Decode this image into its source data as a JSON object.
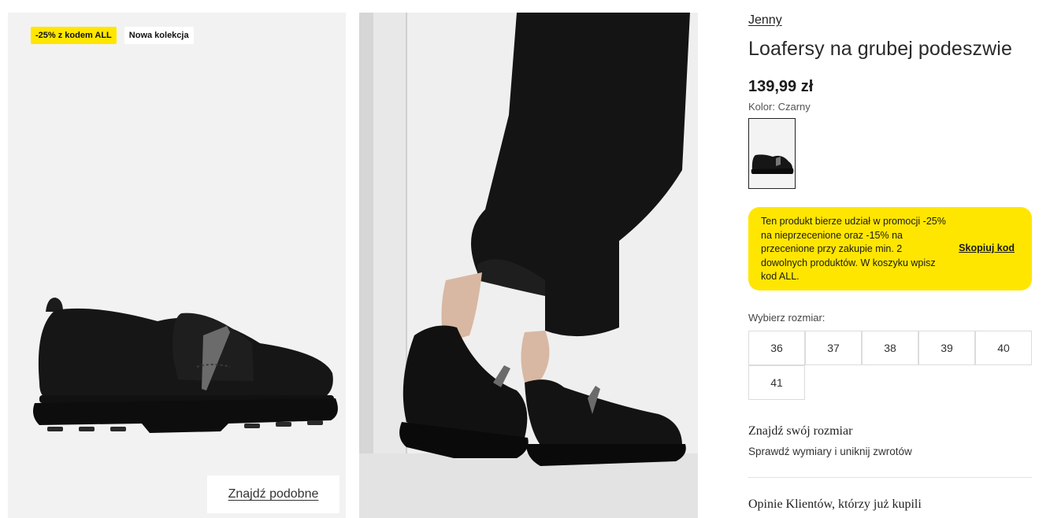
{
  "gallery": {
    "badges": {
      "promo": "-25% z kodem ALL",
      "new": "Nowa kolekcja"
    },
    "find_similar_label": "Znajdź podobne"
  },
  "product": {
    "brand": "Jenny",
    "title": "Loafersy na grubej podeszwie",
    "price": "139,99 zł",
    "color_label": "Kolor: Czarny",
    "promo_text": "Ten produkt bierze udział w promocji -25% na nieprzecenione oraz -15% na przecenione przy zakupie min. 2 dowolnych produktów. W koszyku wpisz kod ALL.",
    "copy_code_label": "Skopiuj kod",
    "promo_color": "#ffe600",
    "size_label": "Wybierz rozmiar:",
    "sizes": [
      "36",
      "37",
      "38",
      "39",
      "40",
      "41"
    ],
    "find_size_title": "Znajdź swój rozmiar",
    "find_size_sub": "Sprawdź wymiary i uniknij zwrotów",
    "reviews_title": "Opinie Klientów, którzy już kupili"
  }
}
